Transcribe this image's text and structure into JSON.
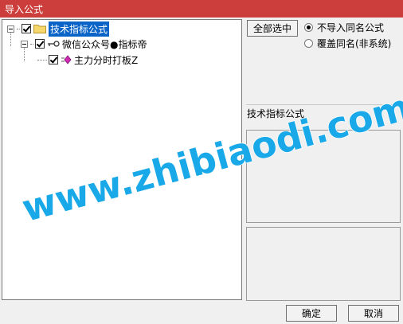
{
  "window": {
    "title": "导入公式"
  },
  "tree": {
    "root": {
      "label": "技术指标公式",
      "icon": "folder-icon"
    },
    "child": {
      "label": "微信公众号●指标帝",
      "icon": "key-icon"
    },
    "leaf": {
      "label": "主力分时打板Z",
      "icon": "diamond-icon"
    }
  },
  "buttons": {
    "select_all": "全部选中",
    "ok": "确定",
    "cancel": "取消"
  },
  "options": {
    "no_import": "不导入同名公式",
    "overwrite": "覆盖同名(非系统)"
  },
  "info": {
    "formula_name": "技术指标公式"
  },
  "watermark": {
    "text": "www.zhibiaodi.com",
    "color": "#19a8e8"
  }
}
